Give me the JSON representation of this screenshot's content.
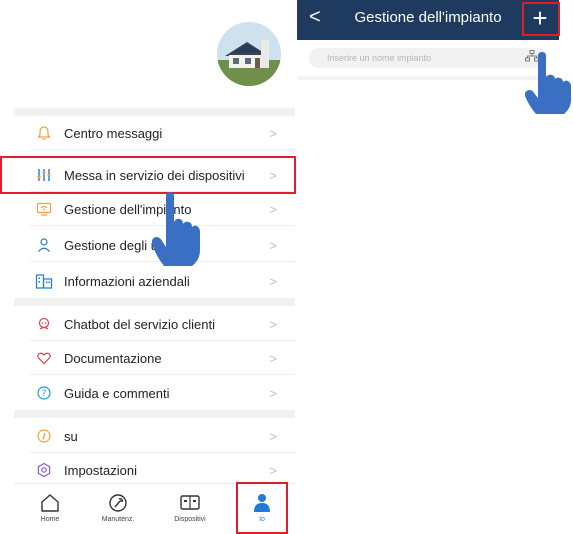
{
  "left": {
    "menu_group1": [
      {
        "label": "Centro messaggi",
        "icon": "bell-icon"
      },
      {
        "label": "Messa in servizio dei dispositivi",
        "icon": "sliders-icon"
      },
      {
        "label": "Gestione dell'impianto",
        "icon": "screen-icon"
      },
      {
        "label": "Gestione degli ut",
        "icon": "person-icon"
      },
      {
        "label": "Informazioni aziendali",
        "icon": "building-icon"
      }
    ],
    "menu_group2": [
      {
        "label": "Chatbot del servizio clienti",
        "icon": "headset-icon"
      },
      {
        "label": "Documentazione",
        "icon": "heart-icon"
      },
      {
        "label": "Guida e commenti",
        "icon": "question-icon"
      }
    ],
    "menu_group3": [
      {
        "label": "su",
        "icon": "info-icon"
      },
      {
        "label": "Impostazioni",
        "icon": "gear-icon"
      }
    ],
    "chevron": ">",
    "tabs": [
      {
        "label": "Home",
        "icon": "home-icon"
      },
      {
        "label": "Manutenz.",
        "icon": "wrench-icon"
      },
      {
        "label": "Dispositivi",
        "icon": "devices-icon"
      },
      {
        "label": "Io",
        "icon": "user-icon",
        "active": true
      }
    ],
    "accent_color": "#1f7ad9",
    "highlight_color": "#e01e2b"
  },
  "right": {
    "title": "Gestione dell'impianto",
    "back": "<",
    "add": "+",
    "search_placeholder": "Inserire un nome impianto",
    "header_color": "#1f3a5f"
  }
}
